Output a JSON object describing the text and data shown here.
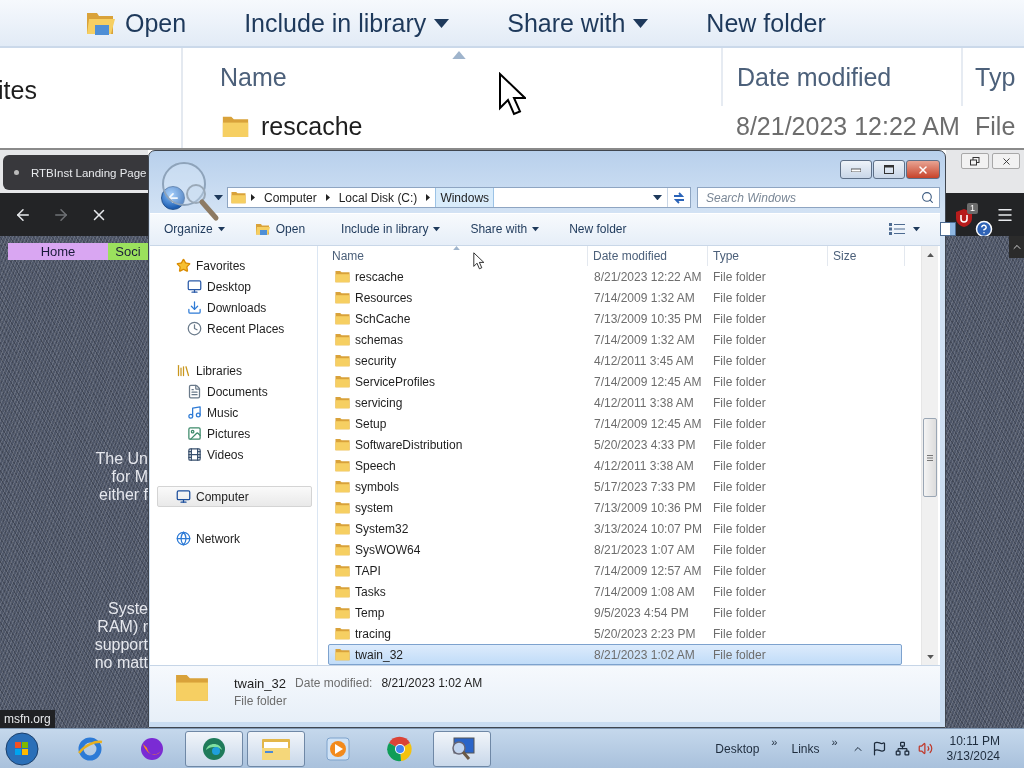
{
  "magnifier": {
    "toolbar": [
      {
        "label": "Open",
        "has_icon": true,
        "dropdown": false
      },
      {
        "label": "Include in library",
        "has_icon": false,
        "dropdown": true
      },
      {
        "label": "Share with",
        "has_icon": false,
        "dropdown": true
      },
      {
        "label": "New folder",
        "has_icon": false,
        "dropdown": false
      }
    ],
    "nav_items": [
      "ites"
    ],
    "columns": [
      {
        "label": "Name",
        "sorted": true
      },
      {
        "label": "Date modified",
        "sorted": false
      },
      {
        "label": "Typ",
        "sorted": false
      }
    ],
    "row": {
      "name": "rescache",
      "date_modified": "8/21/2023 12:22 AM",
      "type": "File"
    }
  },
  "browser": {
    "tab_title": "RTBInst Landing Page",
    "nav_links": [
      {
        "label": "Home",
        "color": "#d9a6f2"
      },
      {
        "label": "Soci",
        "color": "#9be15d"
      }
    ],
    "paragraphs": [
      [
        "The Un",
        "for M",
        "either f"
      ],
      [
        "Syste",
        "RAM) r",
        "support",
        "no matt"
      ]
    ],
    "extension_badge": "1",
    "status": "msfn.org"
  },
  "explorer": {
    "address": [
      {
        "label": "Computer",
        "selected": false
      },
      {
        "label": "Local Disk (C:)",
        "selected": false
      },
      {
        "label": "Windows",
        "selected": true
      }
    ],
    "search": {
      "placeholder": "Search Windows"
    },
    "toolbar": [
      {
        "label": "Organize",
        "has_icon": false,
        "dropdown": true
      },
      {
        "label": "Open",
        "has_icon": true,
        "dropdown": false
      },
      {
        "label": "Include in library",
        "has_icon": false,
        "dropdown": true
      },
      {
        "label": "Share with",
        "has_icon": false,
        "dropdown": true
      },
      {
        "label": "New folder",
        "has_icon": false,
        "dropdown": false
      }
    ],
    "nav": [
      {
        "label": "Favorites",
        "selected": false,
        "children": [
          {
            "label": "Desktop",
            "selected": false
          },
          {
            "label": "Downloads",
            "selected": false
          },
          {
            "label": "Recent Places",
            "selected": false
          }
        ]
      },
      {
        "label": "Libraries",
        "selected": false,
        "children": [
          {
            "label": "Documents",
            "selected": false
          },
          {
            "label": "Music",
            "selected": false
          },
          {
            "label": "Pictures",
            "selected": false
          },
          {
            "label": "Videos",
            "selected": false
          }
        ]
      },
      {
        "label": "Computer",
        "selected": true
      },
      {
        "label": "Network",
        "selected": false
      }
    ],
    "columns": [
      {
        "label": "Name",
        "sorted": true
      },
      {
        "label": "Date modified",
        "sorted": false
      },
      {
        "label": "Type",
        "sorted": false
      },
      {
        "label": "Size",
        "sorted": false
      }
    ],
    "rows": [
      {
        "name": "rescache",
        "date_modified": "8/21/2023 12:22 AM",
        "type": "File folder",
        "selected": false
      },
      {
        "name": "Resources",
        "date_modified": "7/14/2009 1:32 AM",
        "type": "File folder",
        "selected": false
      },
      {
        "name": "SchCache",
        "date_modified": "7/13/2009 10:35 PM",
        "type": "File folder",
        "selected": false
      },
      {
        "name": "schemas",
        "date_modified": "7/14/2009 1:32 AM",
        "type": "File folder",
        "selected": false
      },
      {
        "name": "security",
        "date_modified": "4/12/2011 3:45 AM",
        "type": "File folder",
        "selected": false
      },
      {
        "name": "ServiceProfiles",
        "date_modified": "7/14/2009 12:45 AM",
        "type": "File folder",
        "selected": false
      },
      {
        "name": "servicing",
        "date_modified": "4/12/2011 3:38 AM",
        "type": "File folder",
        "selected": false
      },
      {
        "name": "Setup",
        "date_modified": "7/14/2009 12:45 AM",
        "type": "File folder",
        "selected": false
      },
      {
        "name": "SoftwareDistribution",
        "date_modified": "5/20/2023 4:33 PM",
        "type": "File folder",
        "selected": false
      },
      {
        "name": "Speech",
        "date_modified": "4/12/2011 3:38 AM",
        "type": "File folder",
        "selected": false
      },
      {
        "name": "symbols",
        "date_modified": "5/17/2023 7:33 PM",
        "type": "File folder",
        "selected": false
      },
      {
        "name": "system",
        "date_modified": "7/13/2009 10:36 PM",
        "type": "File folder",
        "selected": false
      },
      {
        "name": "System32",
        "date_modified": "3/13/2024 10:07 PM",
        "type": "File folder",
        "selected": false
      },
      {
        "name": "SysWOW64",
        "date_modified": "8/21/2023 1:07 AM",
        "type": "File folder",
        "selected": false
      },
      {
        "name": "TAPI",
        "date_modified": "7/14/2009 12:57 AM",
        "type": "File folder",
        "selected": false
      },
      {
        "name": "Tasks",
        "date_modified": "7/14/2009 1:08 AM",
        "type": "File folder",
        "selected": false
      },
      {
        "name": "Temp",
        "date_modified": "9/5/2023 4:54 PM",
        "type": "File folder",
        "selected": false
      },
      {
        "name": "tracing",
        "date_modified": "5/20/2023 2:23 PM",
        "type": "File folder",
        "selected": false
      },
      {
        "name": "twain_32",
        "date_modified": "8/21/2023 1:02 AM",
        "type": "File folder",
        "selected": true
      }
    ],
    "details": {
      "name": "twain_32",
      "date_label": "Date modified:",
      "date": "8/21/2023 1:02 AM",
      "type": "File folder"
    }
  },
  "taskbar": {
    "apps": [
      {
        "active": false
      },
      {
        "active": false
      },
      {
        "active": true
      },
      {
        "active": true
      },
      {
        "active": false
      },
      {
        "active": false
      },
      {
        "active": true
      }
    ],
    "toolbars": [
      {
        "label": "Desktop",
        "more": "»"
      },
      {
        "label": "Links",
        "more": "»"
      }
    ],
    "time": "10:11 PM",
    "date": "3/13/2024"
  }
}
